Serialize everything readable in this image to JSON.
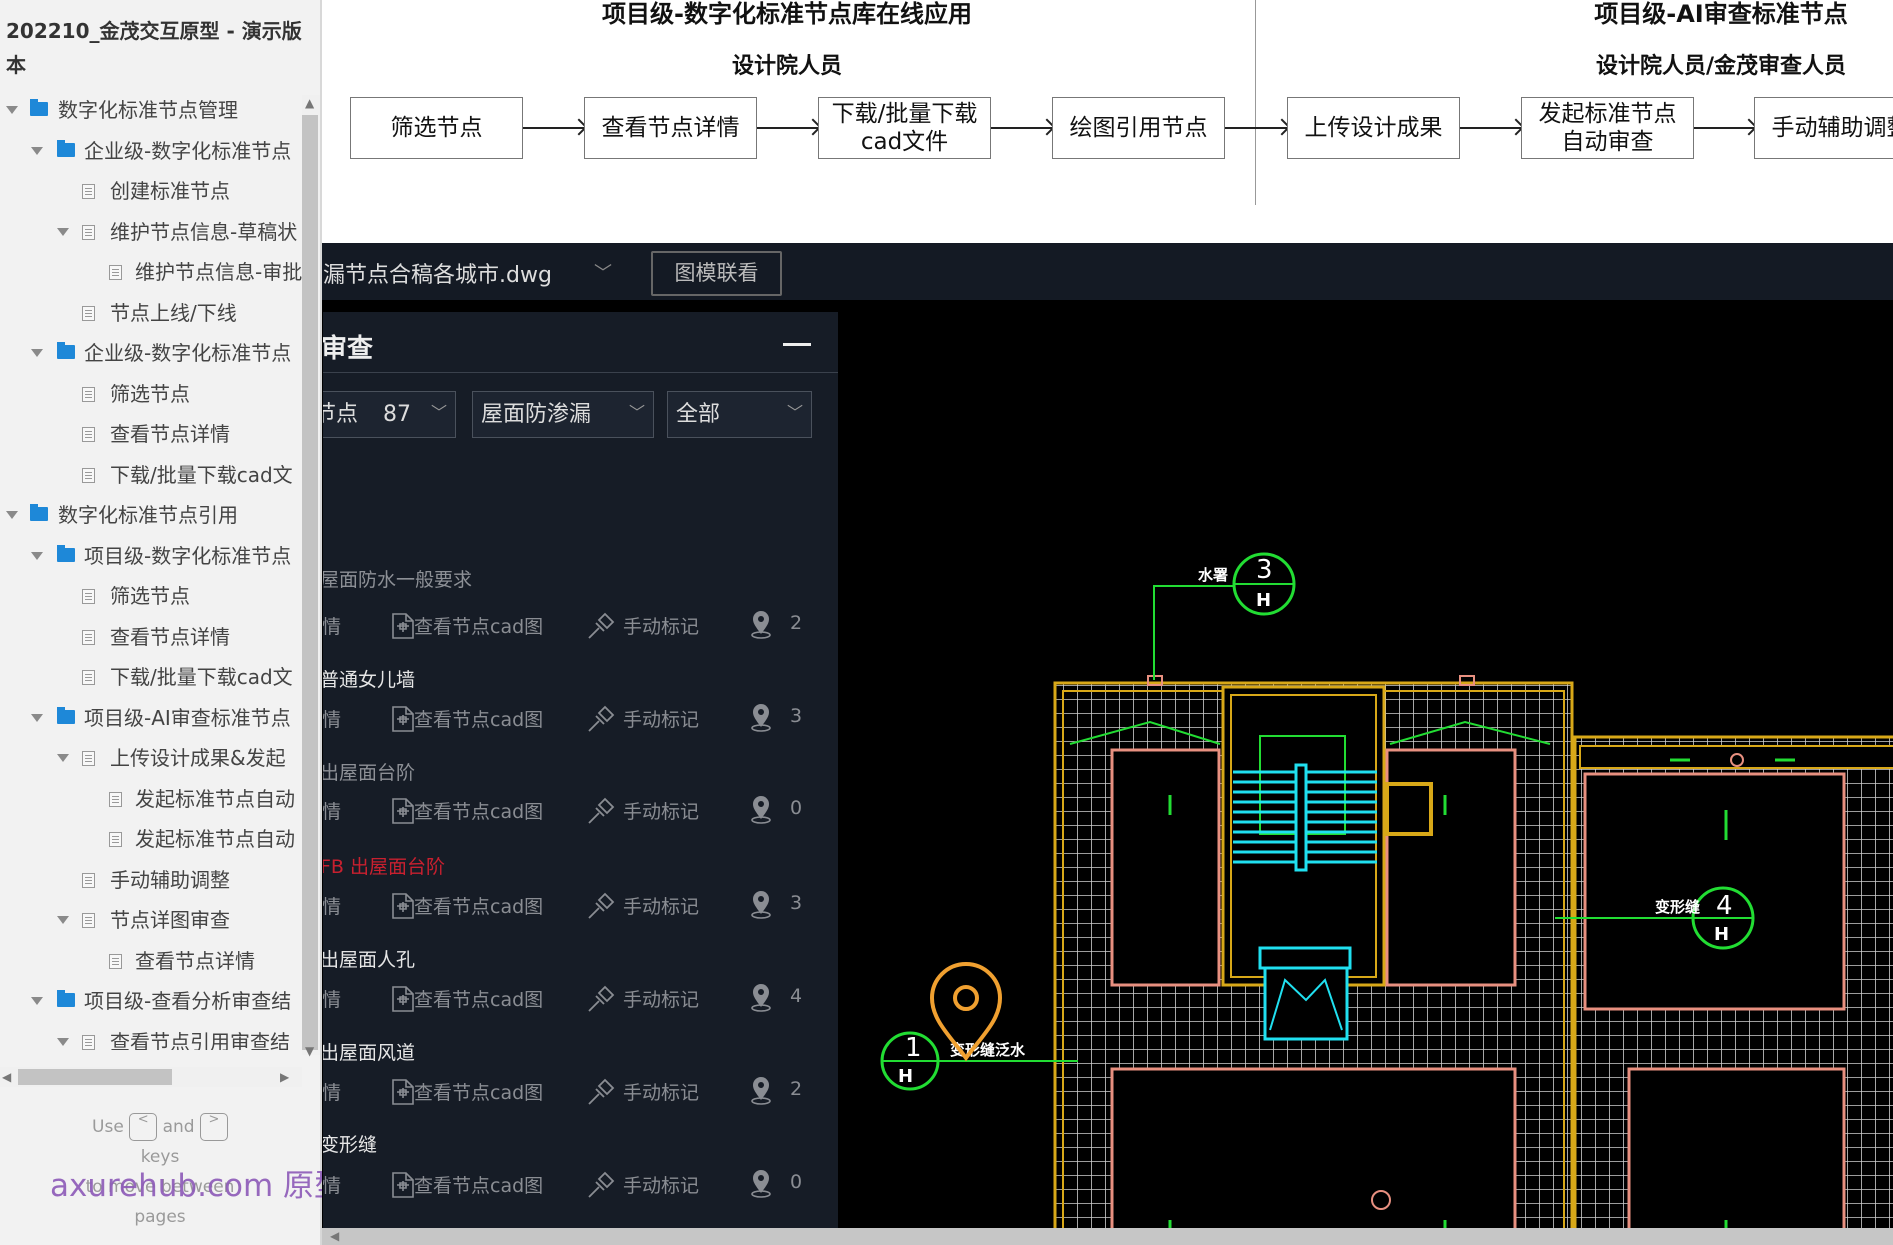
{
  "sidebar": {
    "title": "202210_金茂交互原型 - 演示版本",
    "tree": [
      {
        "level": 0,
        "type": "folder",
        "expanded": true,
        "label": "数字化标准节点管理"
      },
      {
        "level": 1,
        "type": "folder",
        "expanded": true,
        "label": "企业级-数字化标准节点"
      },
      {
        "level": 2,
        "type": "page",
        "expanded": false,
        "label": "创建标准节点"
      },
      {
        "level": 2,
        "type": "page",
        "expanded": true,
        "label": "维护节点信息-草稿状"
      },
      {
        "level": 3,
        "type": "page",
        "expanded": false,
        "label": "维护节点信息-审批"
      },
      {
        "level": 2,
        "type": "page",
        "expanded": false,
        "label": "节点上线/下线"
      },
      {
        "level": 1,
        "type": "folder",
        "expanded": true,
        "label": "企业级-数字化标准节点"
      },
      {
        "level": 2,
        "type": "page",
        "expanded": false,
        "label": "筛选节点"
      },
      {
        "level": 2,
        "type": "page",
        "expanded": false,
        "label": "查看节点详情"
      },
      {
        "level": 2,
        "type": "page",
        "expanded": false,
        "label": "下载/批量下载cad文"
      },
      {
        "level": 0,
        "type": "folder",
        "expanded": true,
        "label": "数字化标准节点引用"
      },
      {
        "level": 1,
        "type": "folder",
        "expanded": true,
        "label": "项目级-数字化标准节点"
      },
      {
        "level": 2,
        "type": "page",
        "expanded": false,
        "label": "筛选节点"
      },
      {
        "level": 2,
        "type": "page",
        "expanded": false,
        "label": "查看节点详情"
      },
      {
        "level": 2,
        "type": "page",
        "expanded": false,
        "label": "下载/批量下载cad文"
      },
      {
        "level": 1,
        "type": "folder",
        "expanded": true,
        "label": "项目级-AI审查标准节点"
      },
      {
        "level": 2,
        "type": "page",
        "expanded": true,
        "label": "上传设计成果&发起"
      },
      {
        "level": 3,
        "type": "page",
        "expanded": false,
        "label": "发起标准节点自动"
      },
      {
        "level": 3,
        "type": "page",
        "expanded": false,
        "label": "发起标准节点自动"
      },
      {
        "level": 2,
        "type": "page",
        "expanded": false,
        "label": "手动辅助调整"
      },
      {
        "level": 2,
        "type": "page",
        "expanded": true,
        "label": "节点详图审查"
      },
      {
        "level": 3,
        "type": "page",
        "expanded": false,
        "label": "查看节点详情"
      },
      {
        "level": 1,
        "type": "folder",
        "expanded": true,
        "label": "项目级-查看分析审查结"
      },
      {
        "level": 2,
        "type": "page",
        "expanded": true,
        "label": "查看节点引用审查结"
      }
    ],
    "footer": {
      "use": "Use",
      "key_prev": "<",
      "and": "and",
      "key_next": ">",
      "line2": "keys",
      "line3": "to move between",
      "line4": "pages"
    },
    "watermark": "axurehub.com 原型资源站"
  },
  "flow": {
    "left_title": "项目级-数字化标准节点库在线应用",
    "left_role": "设计院人员",
    "right_title": "项目级-AI审查标准节点",
    "right_role": "设计院人员/金茂审查人员",
    "steps": [
      "筛选节点",
      "查看节点详情",
      "下载/批量下载cad文件",
      "绘图引用节点",
      "上传设计成果",
      "发起标准节点自动审查",
      "手动辅助调整"
    ]
  },
  "app": {
    "file_name": "漏节点合稿各城市.dwg",
    "link_button": "图模联看",
    "panel": {
      "title": "审查",
      "filters": [
        {
          "label": "节点",
          "count": "87"
        },
        {
          "label": "屋面防渗漏"
        },
        {
          "label": "全部"
        }
      ],
      "action_labels": {
        "detail": "详情",
        "cad": "查看节点cad图",
        "mark": "手动标记"
      },
      "items": [
        {
          "title": "屋面防水一般要求",
          "count": "2",
          "style": "dim"
        },
        {
          "title": "普通女儿墙",
          "count": "3",
          "style": "normal"
        },
        {
          "title": "出屋面台阶",
          "count": "0",
          "style": "dim"
        },
        {
          "title": "FB 出屋面台阶",
          "count": "3",
          "style": "error"
        },
        {
          "title": "出屋面人孔",
          "count": "4",
          "style": "normal"
        },
        {
          "title": "出屋面风道",
          "count": "2",
          "style": "normal"
        },
        {
          "title": "变形缝",
          "count": "0",
          "style": "normal"
        }
      ]
    },
    "cad": {
      "callouts": [
        {
          "text": "水署",
          "number": "3",
          "sub": "H"
        },
        {
          "text": "变形缝",
          "number": "4",
          "sub": "H"
        },
        {
          "text": "变形缝泛水",
          "number": "1",
          "sub": "H"
        }
      ]
    }
  },
  "colors": {
    "error": "#c8202f",
    "pin": "#f0a030",
    "cad_green": "#22dd33",
    "cad_yellow": "#d8a818",
    "cad_pink": "#e89080",
    "cad_cyan": "#20e0f0",
    "folder": "#1e88d8"
  }
}
